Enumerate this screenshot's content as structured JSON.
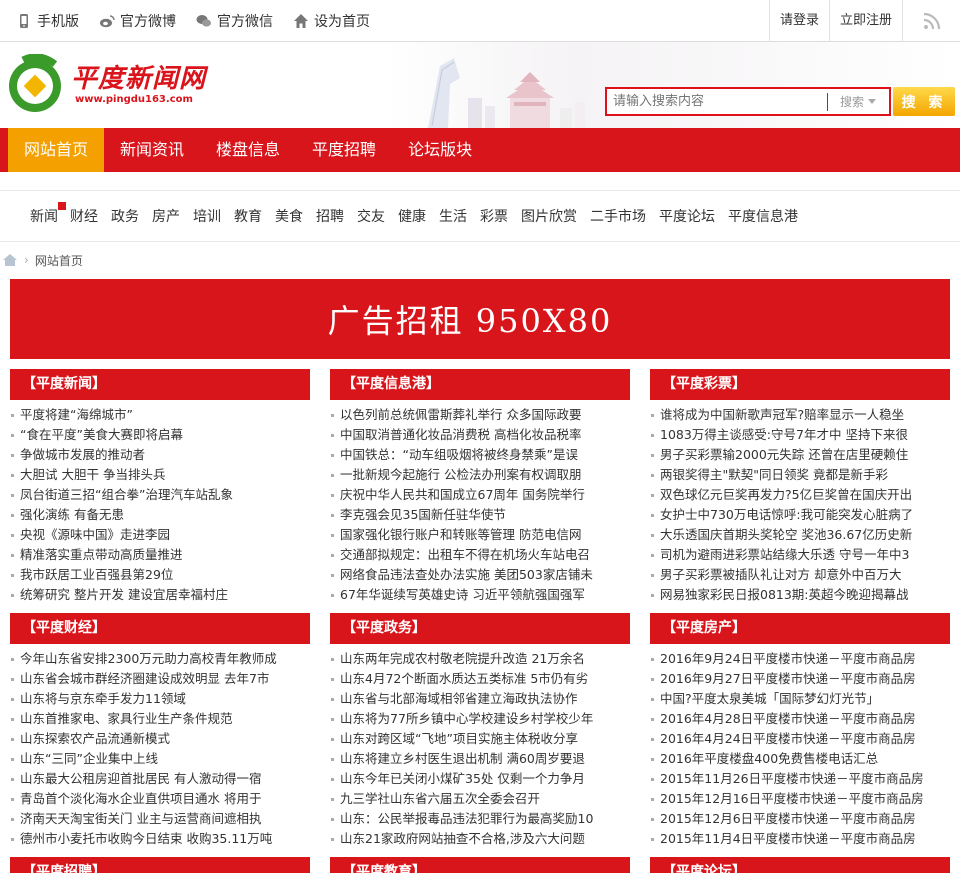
{
  "topbar": {
    "links": [
      {
        "label": "手机版",
        "icon": "mobile-icon"
      },
      {
        "label": "官方微博",
        "icon": "weibo-icon"
      },
      {
        "label": "官方微信",
        "icon": "wechat-icon"
      },
      {
        "label": "设为首页",
        "icon": "home-icon"
      }
    ],
    "login": "请登录",
    "register": "立即注册",
    "rss_icon": "rss-icon"
  },
  "logo": {
    "name": "平度新闻网",
    "url": "www.pingdu163.com"
  },
  "search": {
    "placeholder": "请输入搜索内容",
    "type": "搜索",
    "button": "搜 索"
  },
  "mainnav": [
    "网站首页",
    "新闻资讯",
    "楼盘信息",
    "平度招聘",
    "论坛版块"
  ],
  "subnav": [
    "新闻",
    "财经",
    "政务",
    "房产",
    "培训",
    "教育",
    "美食",
    "招聘",
    "交友",
    "健康",
    "生活",
    "彩票",
    "图片欣赏",
    "二手市场",
    "平度论坛",
    "平度信息港"
  ],
  "breadcrumb": {
    "current": "网站首页"
  },
  "banner": "广告招租 950X80",
  "panels": [
    {
      "title": "【平度新闻】",
      "items": [
        "平度将建“海绵城市”",
        "“食在平度”美食大赛即将启幕",
        "争做城市发展的推动者",
        "大胆试 大胆干 争当排头兵",
        "凤台街道三招“组合拳”治理汽车站乱象",
        "强化演练 有备无患",
        "央视《源味中国》走进李园",
        "精准落实重点带动高质量推进",
        "我市跃居工业百强县第29位",
        "统筹研究 整片开发 建设宜居幸福村庄"
      ]
    },
    {
      "title": "【平度信息港】",
      "items": [
        "以色列前总统佩雷斯葬礼举行 众多国际政要",
        "中国取消普通化妆品消费税 高档化妆品税率",
        "中国铁总：“动车组吸烟将被终身禁乘”是误",
        "一批新规今起施行 公检法办刑案有权调取朋",
        "庆祝中华人民共和国成立67周年 国务院举行",
        "李克强会见35国新任驻华使节",
        "国家强化银行账户和转账等管理 防范电信网",
        "交通部拟规定：出租车不得在机场火车站电召",
        "网络食品违法查处办法实施 美团503家店铺未",
        "67年华诞续写英雄史诗 习近平领航强国强军"
      ]
    },
    {
      "title": "【平度彩票】",
      "items": [
        "谁将成为中国新歌声冠军?赔率显示一人稳坐",
        "1083万得主谈感受:守号7年才中 坚持下来很",
        "男子买彩票输2000元失踪 还曾在店里硬赖住",
        "两银奖得主\"默契\"同日领奖 竟都是新手彩",
        "双色球亿元巨奖再发力?5亿巨奖曾在国庆开出",
        "女护士中730万电话惊呼:我可能突发心脏病了",
        "大乐透国庆首期头奖轮空 奖池36.67亿历史新",
        "司机为避雨进彩票站结缘大乐透 守号一年中3",
        "男子买彩票被插队礼让对方 却意外中百万大",
        "网易独家彩民日报0813期:英超今晚迎揭幕战"
      ]
    },
    {
      "title": "【平度财经】",
      "items": [
        "今年山东省安排2300万元助力高校青年教师成",
        "山东省会城市群经济圈建设成效明显 去年7市",
        "山东将与京东牵手发力11领域",
        "山东首推家电、家具行业生产条件规范",
        "山东探索农产品流通新模式",
        "山东“三同”企业集中上线",
        "山东最大公租房迎首批居民 有人激动得一宿",
        "青岛首个淡化海水企业直供项目通水 将用于",
        "济南天天淘宝街关门 业主与运营商间遮相执",
        "德州市小麦托市收购今日结束 收购35.11万吨"
      ]
    },
    {
      "title": "【平度政务】",
      "items": [
        "山东两年完成农村敬老院提升改造 21万余名",
        "山东4月72个断面水质达五类标准 5市仍有劣",
        "山东省与北部海域相邻省建立海政执法协作",
        "山东将为77所乡镇中心学校建设乡村学校少年",
        "山东对跨区域“飞地”项目实施主体税收分享",
        "山东将建立乡村医生退出机制 满60周岁要退",
        "山东今年已关闭小煤矿35处 仅剩一个力争月",
        "九三学社山东省六届五次全委会召开",
        "山东：公民举报毒品违法犯罪行为最高奖励10",
        "山东21家政府网站抽查不合格,涉及六大问题"
      ]
    },
    {
      "title": "【平度房产】",
      "items": [
        "2016年9月24日平度楼市快递－平度市商品房",
        "2016年9月27日平度楼市快递－平度市商品房",
        "中国?平度太泉美城「国际梦幻灯光节」",
        "2016年4月28日平度楼市快递－平度市商品房",
        "2016年4月24日平度楼市快递－平度市商品房",
        "2016年平度楼盘400免费售楼电话汇总",
        "2015年11月26日平度楼市快递－平度市商品房",
        "2015年12月16日平度楼市快递－平度市商品房",
        "2015年12月6日平度楼市快递－平度市商品房",
        "2015年11月4日平度楼市快递－平度市商品房"
      ]
    },
    {
      "title": "【平度招聘】",
      "items": []
    },
    {
      "title": "【平度教育】",
      "items": []
    },
    {
      "title": "【平度论坛】",
      "items": []
    }
  ],
  "colors": {
    "brand_red": "#d9151c",
    "accent_orange": "#f4a000"
  }
}
